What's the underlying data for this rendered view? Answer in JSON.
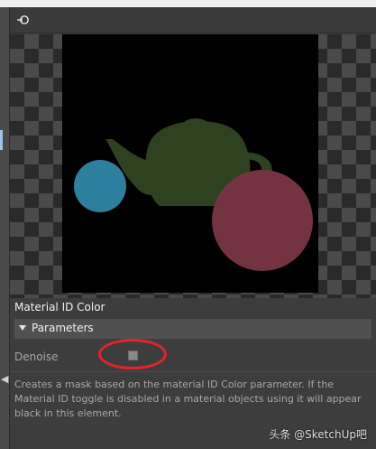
{
  "colors": {
    "panel_bg": "#3d3d3d",
    "render_bg": "#000000",
    "teapot": "#2e4220",
    "blue_sphere": "#2d7f9e",
    "red_sphere": "#743341",
    "highlight": "#e3242b"
  },
  "header": {
    "icon": "node-graph-icon"
  },
  "node": {
    "title": "Material ID Color"
  },
  "parameters": {
    "section_label": "Parameters",
    "denoise_label": "Denoise"
  },
  "description": "Creates a mask based on the material ID Color parameter. If the Material ID toggle is disabled in a material objects using it will appear black in this element.",
  "watermark": "头条 @SketchUp吧"
}
